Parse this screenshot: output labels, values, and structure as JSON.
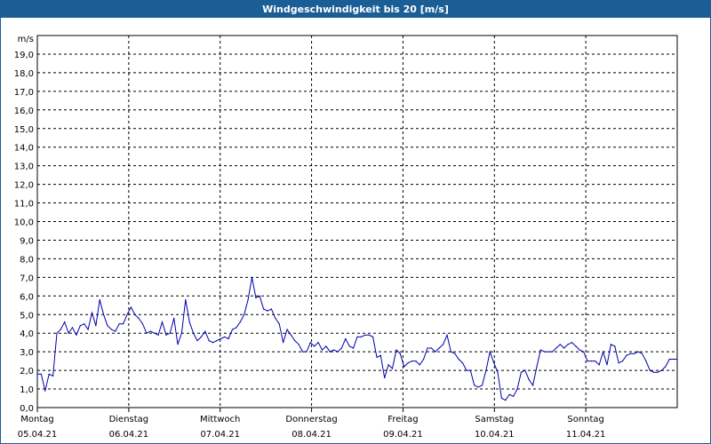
{
  "title": "Windgeschwindigkeit bis 20 [m/s]",
  "colors": {
    "titlebar": "#1b5e96",
    "line": "#0000aa",
    "grid": "#000000"
  },
  "chart_data": {
    "type": "line",
    "title": "Windgeschwindigkeit bis 20 [m/s]",
    "ylabel": "m/s",
    "ylim": [
      0,
      20
    ],
    "ytick_labels": [
      "0,0",
      "1,0",
      "2,0",
      "3,0",
      "4,0",
      "5,0",
      "6,0",
      "7,0",
      "8,0",
      "9,0",
      "10,0",
      "11,0",
      "12,0",
      "13,0",
      "14,0",
      "15,0",
      "16,0",
      "17,0",
      "18,0",
      "19,0"
    ],
    "xlim": [
      "2021-04-05",
      "2021-04-12"
    ],
    "xticks": [
      {
        "day": "Montag",
        "date": "05.04.21"
      },
      {
        "day": "Dienstag",
        "date": "06.04.21"
      },
      {
        "day": "Mittwoch",
        "date": "07.04.21"
      },
      {
        "day": "Donnerstag",
        "date": "08.04.21"
      },
      {
        "day": "Freitag",
        "date": "09.04.21"
      },
      {
        "day": "Samstag",
        "date": "10.04.21"
      },
      {
        "day": "Sonntag",
        "date": "11.04.21"
      }
    ],
    "grid": true,
    "series": [
      {
        "values": [
          1.8,
          1.8,
          0.9,
          1.8,
          1.7,
          4.0,
          4.2,
          4.6,
          4.0,
          4.3,
          3.9,
          4.4,
          4.5,
          4.2,
          5.1,
          4.4,
          5.8,
          5.0,
          4.4,
          4.2,
          4.1,
          4.5,
          4.5,
          5.0,
          5.4,
          5.0,
          4.8,
          4.5,
          4.0,
          4.1,
          4.0,
          3.9,
          4.6,
          3.9,
          4.0,
          4.8,
          3.4,
          4.0,
          5.8,
          4.6,
          4.0,
          3.6,
          3.8,
          4.1,
          3.6,
          3.5,
          3.6,
          3.7,
          3.8,
          3.7,
          4.2,
          4.3,
          4.6,
          5.0,
          5.8,
          7.0,
          5.9,
          6.0,
          5.3,
          5.2,
          5.3,
          4.8,
          4.5,
          3.5,
          4.2,
          3.9,
          3.6,
          3.4,
          3.0,
          3.0,
          3.5,
          3.3,
          3.5,
          3.1,
          3.3,
          3.0,
          3.1,
          3.0,
          3.2,
          3.7,
          3.3,
          3.2,
          3.8,
          3.8,
          3.9,
          3.9,
          3.8,
          2.7,
          2.8,
          1.6,
          2.3,
          2.1,
          3.1,
          2.9,
          2.2,
          2.4,
          2.5,
          2.5,
          2.3,
          2.6,
          3.2,
          3.2,
          3.0,
          3.2,
          3.4,
          3.9,
          3.0,
          2.9,
          2.6,
          2.4,
          2.0,
          2.0,
          1.2,
          1.1,
          1.2,
          2.0,
          3.0,
          2.4,
          1.9,
          0.5,
          0.4,
          0.7,
          0.6,
          1.0,
          1.9,
          2.0,
          1.5,
          1.2,
          2.2,
          3.1,
          3.0,
          3.0,
          3.0,
          3.2,
          3.4,
          3.2,
          3.4,
          3.5,
          3.3,
          3.1,
          3.0,
          2.5,
          2.5,
          2.5,
          2.3,
          3.0,
          2.3,
          3.4,
          3.3,
          2.4,
          2.5,
          2.8,
          2.9,
          2.9,
          3.0,
          2.9,
          2.5,
          2.0,
          1.9,
          1.9,
          2.0,
          2.2,
          2.6,
          2.6,
          2.6
        ]
      }
    ]
  }
}
